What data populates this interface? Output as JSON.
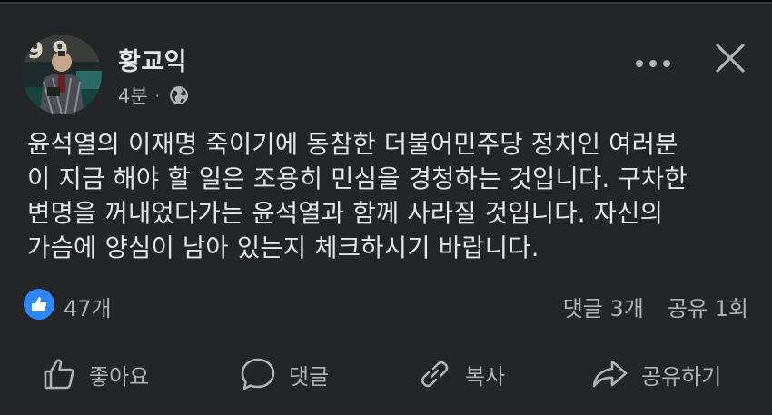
{
  "post": {
    "author": "황교익",
    "time": "4분",
    "separator": "·",
    "privacy_icon": "globe-icon",
    "text": "윤석열의 이재명 죽이기에 동참한 더불어민주당 정치인 여러분\n이 지금 해야 할 일은 조용히 민심을 경청하는 것입니다. 구차한\n변명을 꺼내었다가는 윤석열과 함께 사라질 것입니다. 자신의\n가슴에 양심이 남아 있는지 체크하시기 바랍니다."
  },
  "stats": {
    "reaction_icon": "thumbs-up-icon",
    "likes": "47개",
    "comments": "댓글 3개",
    "shares": "공유 1회"
  },
  "actions": {
    "like": "좋아요",
    "comment": "댓글",
    "copy": "복사",
    "share": "공유하기"
  },
  "colors": {
    "background": "#242526",
    "text": "#e4e6eb",
    "secondary_text": "#b0b3b8",
    "accent": "#2d88ff"
  }
}
